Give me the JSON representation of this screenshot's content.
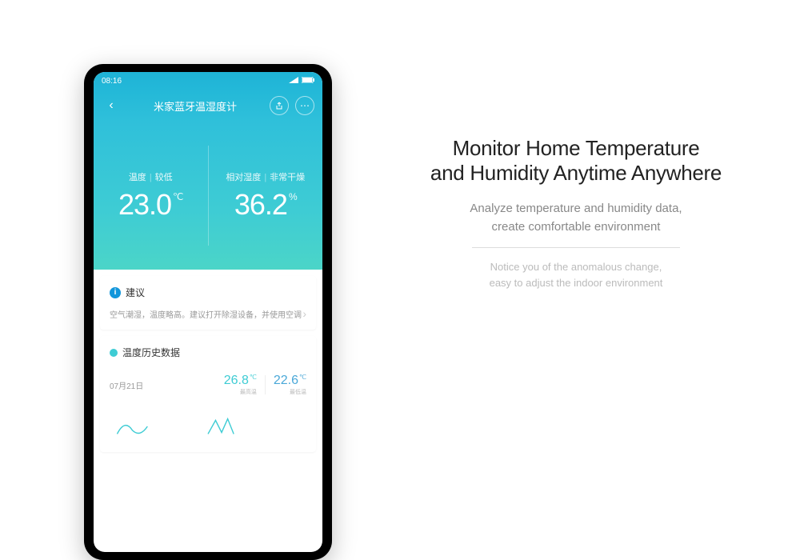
{
  "status": {
    "time": "08:16"
  },
  "title": "米家蓝牙温湿度计",
  "hero": {
    "temp": {
      "label": "温度",
      "status": "较低",
      "value": "23.0",
      "unit": "℃"
    },
    "humidity": {
      "label": "相对湿度",
      "status": "非常干燥",
      "value": "36.2",
      "unit": "%"
    }
  },
  "suggestion": {
    "header": "建议",
    "text": "空气潮湿，温度略高。建议打开除湿设备，并使用空调"
  },
  "history": {
    "header": "温度历史数据",
    "date": "07月21日",
    "high": {
      "value": "26.8",
      "unit": "℃",
      "label": "最高温"
    },
    "low": {
      "value": "22.6",
      "unit": "℃",
      "label": "最低温"
    }
  },
  "marketing": {
    "headline1": "Monitor Home Temperature",
    "headline2": "and Humidity Anytime Anywhere",
    "sub1": "Analyze temperature and humidity data,",
    "sub2": "create comfortable environment",
    "note1": "Notice you of the anomalous change,",
    "note2": "easy to adjust the indoor environment"
  }
}
